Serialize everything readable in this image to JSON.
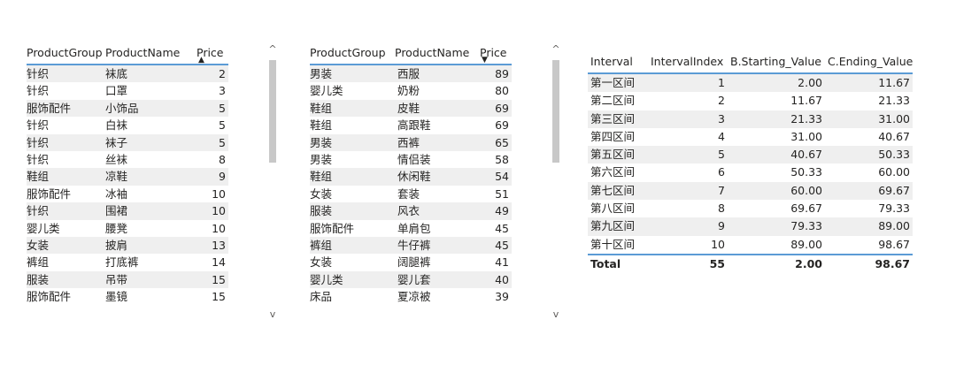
{
  "table1": {
    "headers": [
      "ProductGroup",
      "ProductName",
      "Price"
    ],
    "sort_arrow": "▲",
    "rows": [
      [
        "针织",
        "袜底",
        "2"
      ],
      [
        "针织",
        "口罩",
        "3"
      ],
      [
        "服饰配件",
        "小饰品",
        "5"
      ],
      [
        "针织",
        "白袜",
        "5"
      ],
      [
        "针织",
        "袜子",
        "5"
      ],
      [
        "针织",
        "丝袜",
        "8"
      ],
      [
        "鞋组",
        "凉鞋",
        "9"
      ],
      [
        "服饰配件",
        "冰袖",
        "10"
      ],
      [
        "针织",
        "围裙",
        "10"
      ],
      [
        "婴儿类",
        "腰凳",
        "10"
      ],
      [
        "女装",
        "披肩",
        "13"
      ],
      [
        "裤组",
        "打底裤",
        "14"
      ],
      [
        "服装",
        "吊带",
        "15"
      ],
      [
        "服饰配件",
        "墨镜",
        "15"
      ]
    ]
  },
  "table2": {
    "headers": [
      "ProductGroup",
      "ProductName",
      "Price"
    ],
    "sort_arrow": "▼",
    "rows": [
      [
        "男装",
        "西服",
        "89"
      ],
      [
        "婴儿类",
        "奶粉",
        "80"
      ],
      [
        "鞋组",
        "皮鞋",
        "69"
      ],
      [
        "鞋组",
        "高跟鞋",
        "69"
      ],
      [
        "男装",
        "西裤",
        "65"
      ],
      [
        "男装",
        "情侣装",
        "58"
      ],
      [
        "鞋组",
        "休闲鞋",
        "54"
      ],
      [
        "女装",
        "套装",
        "51"
      ],
      [
        "服装",
        "风衣",
        "49"
      ],
      [
        "服饰配件",
        "单肩包",
        "45"
      ],
      [
        "裤组",
        "牛仔裤",
        "45"
      ],
      [
        "女装",
        "阔腿裤",
        "41"
      ],
      [
        "婴儿类",
        "婴儿套",
        "40"
      ],
      [
        "床品",
        "夏凉被",
        "39"
      ]
    ]
  },
  "table3": {
    "headers": [
      "Interval",
      "IntervalIndex",
      "B.Starting_Value",
      "C.Ending_Value"
    ],
    "rows": [
      [
        "第一区间",
        "1",
        "2.00",
        "11.67"
      ],
      [
        "第二区间",
        "2",
        "11.67",
        "21.33"
      ],
      [
        "第三区间",
        "3",
        "21.33",
        "31.00"
      ],
      [
        "第四区间",
        "4",
        "31.00",
        "40.67"
      ],
      [
        "第五区间",
        "5",
        "40.67",
        "50.33"
      ],
      [
        "第六区间",
        "6",
        "50.33",
        "60.00"
      ],
      [
        "第七区间",
        "7",
        "60.00",
        "69.67"
      ],
      [
        "第八区间",
        "8",
        "69.67",
        "79.33"
      ],
      [
        "第九区间",
        "9",
        "79.33",
        "89.00"
      ],
      [
        "第十区间",
        "10",
        "89.00",
        "98.67"
      ]
    ],
    "total": [
      "Total",
      "55",
      "2.00",
      "98.67"
    ]
  },
  "scroll": {
    "up": "^",
    "down": "v"
  }
}
